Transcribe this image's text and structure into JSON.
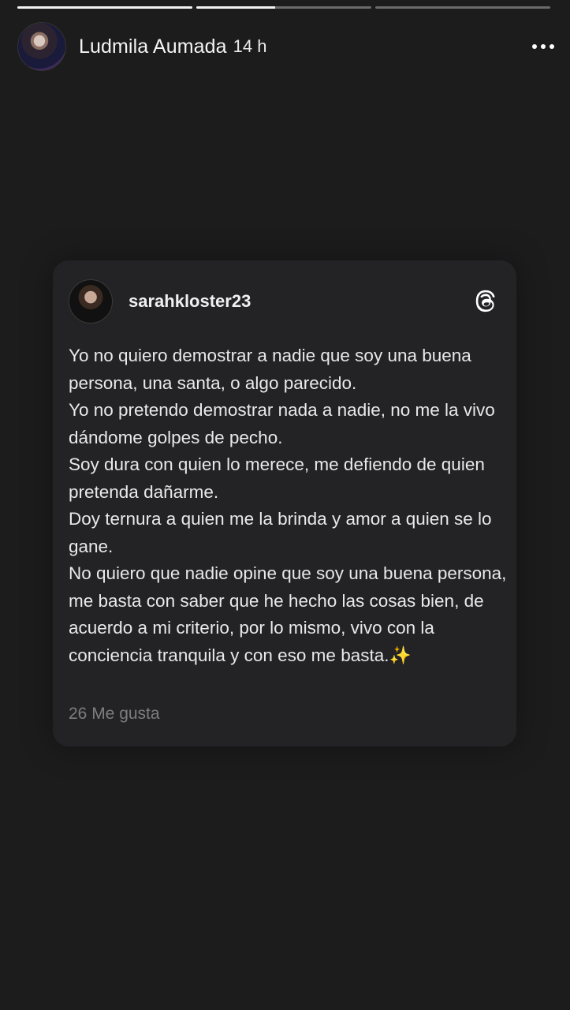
{
  "story": {
    "progress": [
      1.0,
      0.45,
      0.0
    ],
    "author": "Ludmila Aumada",
    "time": "14 h"
  },
  "post": {
    "username": "sarahkloster23",
    "paragraphs": [
      "Yo no quiero demostrar a nadie que soy una buena persona, una santa,  o algo parecido.",
      "Yo no pretendo demostrar nada a nadie, no me la vivo dándome golpes de pecho.",
      "Soy dura con quien lo merece, me defiendo de quien pretenda dañarme.",
      "Doy ternura a quien me la brinda y amor a quien se lo gane.",
      "No quiero que nadie opine que soy una buena persona, me basta con saber que he hecho las cosas bien, de acuerdo a mi criterio, por lo mismo, vivo con la conciencia tranquila y con eso me basta.✨"
    ],
    "likes": "26 Me gusta"
  },
  "icons": {
    "more": "more-options-icon",
    "threads": "threads-logo-icon"
  },
  "colors": {
    "background": "#1c1c1c",
    "card": "#232326",
    "text": "#e9e9e9",
    "muted": "#7d7d80"
  }
}
